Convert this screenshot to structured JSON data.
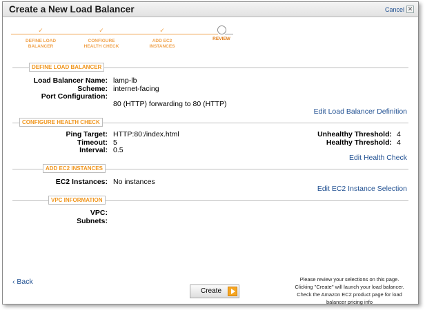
{
  "dialog": {
    "title": "Create a New Load Balancer",
    "cancel_label": "Cancel"
  },
  "steps": [
    {
      "label_1": "DEFINE LOAD",
      "label_2": "BALANCER",
      "check": "✓"
    },
    {
      "label_1": "CONFIGURE",
      "label_2": "HEALTH CHECK",
      "check": "✓"
    },
    {
      "label_1": "ADD EC2",
      "label_2": "INSTANCES",
      "check": "✓"
    },
    {
      "label_1": "REVIEW",
      "label_2": ""
    }
  ],
  "sections": {
    "define": {
      "heading": "DEFINE LOAD BALANCER",
      "name_label": "Load Balancer Name:",
      "name_value": "lamp-lb",
      "scheme_label": "Scheme:",
      "scheme_value": "internet-facing",
      "port_label": "Port Configuration:",
      "port_value": "80 (HTTP) forwarding to 80 (HTTP)",
      "edit_link": "Edit Load Balancer Definition"
    },
    "health": {
      "heading": "CONFIGURE HEALTH CHECK",
      "ping_label": "Ping Target:",
      "ping_value": "HTTP:80:/index.html",
      "timeout_label": "Timeout:",
      "timeout_value": "5",
      "interval_label": "Interval:",
      "interval_value": "0.5",
      "unhealthy_label": "Unhealthy Threshold:",
      "unhealthy_value": "4",
      "healthy_label": "Healthy Threshold:",
      "healthy_value": "4",
      "edit_link": "Edit Health Check"
    },
    "ec2": {
      "heading": "ADD EC2 INSTANCES",
      "instances_label": "EC2 Instances:",
      "instances_value": "No instances",
      "edit_link": "Edit EC2 Instance Selection"
    },
    "vpc": {
      "heading": "VPC INFORMATION",
      "vpc_label": "VPC:",
      "subnets_label": "Subnets:"
    }
  },
  "footer": {
    "back_label": "‹ Back",
    "create_label": "Create",
    "note_lines": [
      "Please review your selections on this page.",
      "Clicking \"Create\" will launch your load balancer.",
      "Check the Amazon EC2 product page for load",
      "balancer pricing info"
    ]
  }
}
